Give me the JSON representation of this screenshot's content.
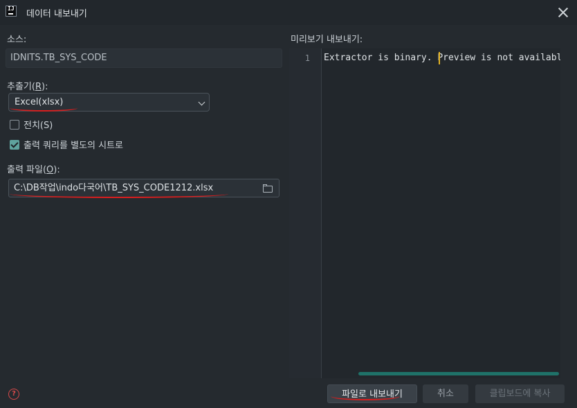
{
  "window": {
    "title": "데이터 내보내기"
  },
  "source": {
    "label": "소스:",
    "value": "IDNITS.TB_SYS_CODE"
  },
  "extractor": {
    "label_prefix": "추출기(",
    "label_mnemonic": "R",
    "label_suffix": "):",
    "selected": "Excel(xlsx)"
  },
  "options": {
    "transpose_label": "전치(S)",
    "transpose_checked": false,
    "separate_sheet_label": "출력 쿼리를 별도의 시트로",
    "separate_sheet_checked": true
  },
  "output_file": {
    "label_prefix": "출력 파일(",
    "label_mnemonic": "O",
    "label_suffix": "):",
    "value": "C:\\DB작업\\indo다국어\\TB_SYS_CODE1212.xlsx"
  },
  "preview": {
    "label": "미리보기 내보내기:",
    "line_number": "1",
    "text": "Extractor is binary. Preview is not available."
  },
  "buttons": {
    "export_file": "파일로 내보내기",
    "cancel": "취소",
    "copy_clipboard": "클립보드에 복사"
  },
  "colors": {
    "accent": "#1f7269",
    "annotation": "#d91e1e",
    "caret": "#e6b422"
  }
}
